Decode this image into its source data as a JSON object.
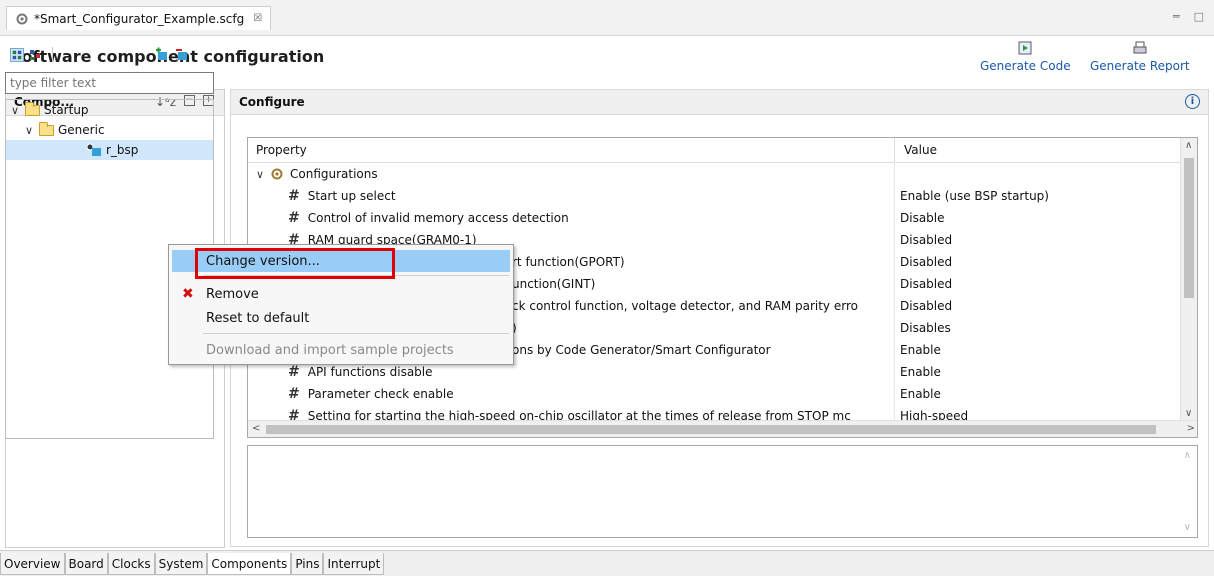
{
  "editor_tab": {
    "title": "*Smart_Configurator_Example.scfg",
    "close": "☒"
  },
  "window_controls": {
    "minimize": "═",
    "maximize": "□"
  },
  "header": {
    "title": "Software component configuration",
    "generate_code": "Generate Code",
    "generate_report": "Generate Report"
  },
  "components_panel": {
    "title": "Compo...",
    "filter_placeholder": "type filter text",
    "tree": [
      {
        "label": "Startup",
        "level": 0,
        "expanded": true
      },
      {
        "label": "Generic",
        "level": 1,
        "expanded": true
      },
      {
        "label": "r_bsp",
        "level": 2,
        "selected": true
      }
    ]
  },
  "configure_panel": {
    "title": "Configure",
    "columns": {
      "property": "Property",
      "value": "Value"
    },
    "rows": [
      {
        "property": "Configurations",
        "value": "",
        "group": true
      },
      {
        "property": "Start up select",
        "value": "Enable (use BSP startup)"
      },
      {
        "property": "Control of invalid memory access detection",
        "value": "Disable"
      },
      {
        "property": "RAM guard space(GRAM0-1)",
        "value": "Disabled"
      },
      {
        "property": "rt function(GPORT)",
        "value": "Disabled"
      },
      {
        "property": "unction(GINT)",
        "value": "Disabled"
      },
      {
        "property": "ck control function, voltage detector, and RAM parity erro",
        "value": "Disabled"
      },
      {
        "property": ")",
        "value": "Disables"
      },
      {
        "property": "ons by Code Generator/Smart Configurator",
        "value": "Enable"
      },
      {
        "property": "API functions disable",
        "value": "Enable"
      },
      {
        "property": "Parameter check enable",
        "value": "Enable"
      },
      {
        "property": "Setting for starting the high-speed on-chip oscillator at the times of release from STOP mc",
        "value": "High-speed"
      }
    ]
  },
  "context_menu": {
    "items": [
      {
        "label": "Change version...",
        "highlighted": true
      },
      {
        "label": "Remove"
      },
      {
        "label": "Reset to default"
      },
      {
        "label": "Download and import sample projects",
        "disabled": true
      }
    ]
  },
  "bottom_tabs": [
    "Overview",
    "Board",
    "Clocks",
    "System",
    "Components",
    "Pins",
    "Interrupt"
  ],
  "active_bottom_tab": "Components",
  "colors": {
    "selection": "#99ccf7",
    "highlight_box": "#e00000",
    "link": "#1a5aa8"
  }
}
